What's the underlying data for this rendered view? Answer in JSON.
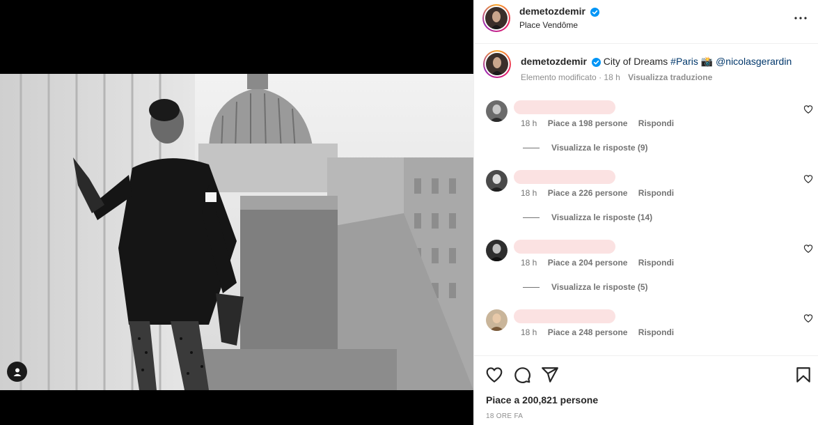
{
  "post": {
    "username": "demetozdemir",
    "location": "Place Vendôme"
  },
  "caption": {
    "username": "demetozdemir",
    "text": "City of Dreams",
    "hashtag": "#Paris",
    "emoji": "📸",
    "mention": "@nicolasgerardin",
    "edited_label": "Elemento modificato",
    "separator": "·",
    "time": "18 h",
    "translate_label": "Visualizza traduzione"
  },
  "comments": [
    {
      "time": "18 h",
      "likes": "Piace a 198 persone",
      "reply": "Rispondi",
      "view_replies": "Visualizza le risposte (9)"
    },
    {
      "time": "18 h",
      "likes": "Piace a 226 persone",
      "reply": "Rispondi",
      "view_replies": "Visualizza le risposte (14)"
    },
    {
      "time": "18 h",
      "likes": "Piace a 204 persone",
      "reply": "Rispondi",
      "view_replies": "Visualizza le risposte (5)"
    },
    {
      "time": "18 h",
      "likes": "Piace a 248 persone",
      "reply": "Rispondi"
    }
  ],
  "footer": {
    "likes_total": "Piace a 200,821 persone",
    "posted_ago": "18 ORE FA"
  },
  "icons": {
    "verified": "verified-badge-icon",
    "more": "more-options-icon",
    "like": "heart-icon",
    "comment": "comment-icon",
    "share": "share-icon",
    "save": "bookmark-icon",
    "tag": "user-tag-icon"
  },
  "colors": {
    "accent_link": "#00376b",
    "verified_blue": "#0095f6",
    "muted": "#737373",
    "border": "#efefef"
  }
}
